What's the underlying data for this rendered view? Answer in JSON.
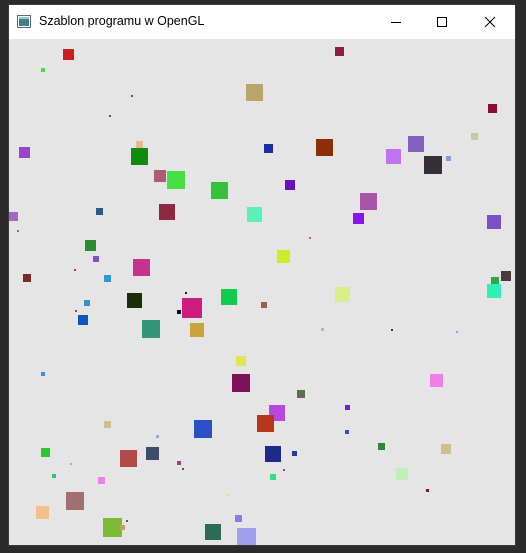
{
  "window": {
    "title": "Szablon programu w OpenGL",
    "icons": {
      "app": "opengl-window-app-icon",
      "minimize": "minimize-icon",
      "maximize": "maximize-icon",
      "close": "close-icon"
    }
  },
  "canvas": {
    "background": "#e5e5e5",
    "description_colors": {
      "title_bar": "#ffffff",
      "frame": "#2b2b2b"
    }
  }
}
